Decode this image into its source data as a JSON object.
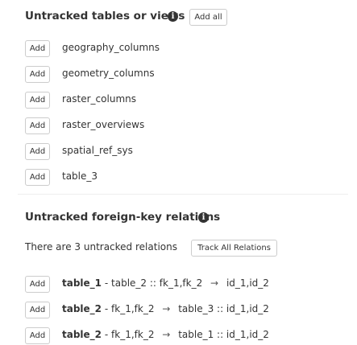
{
  "untracked_tables": {
    "title": "Untracked tables or views",
    "add_all_label": "Add all",
    "items": [
      {
        "add_label": "Add",
        "name": "geography_columns"
      },
      {
        "add_label": "Add",
        "name": "geometry_columns"
      },
      {
        "add_label": "Add",
        "name": "raster_columns"
      },
      {
        "add_label": "Add",
        "name": "raster_overviews"
      },
      {
        "add_label": "Add",
        "name": "spatial_ref_sys"
      },
      {
        "add_label": "Add",
        "name": "table_3"
      }
    ]
  },
  "untracked_relations": {
    "title": "Untracked foreign-key relations",
    "summary": "There are 3 untracked relations",
    "track_all_label": "Track All Relations",
    "items": [
      {
        "add_label": "Add",
        "table": "table_1",
        "sep": "-",
        "left": "table_2 :: fk_1,fk_2",
        "arrow": "→",
        "right": "id_1,id_2"
      },
      {
        "add_label": "Add",
        "table": "table_2",
        "sep": "-",
        "left": "fk_1,fk_2",
        "arrow": "→",
        "right": "table_3 :: id_1,id_2"
      },
      {
        "add_label": "Add",
        "table": "table_2",
        "sep": "-",
        "left": "fk_1,fk_2",
        "arrow": "→",
        "right": "table_1 :: id_1,id_2"
      }
    ]
  },
  "info_icon_glyph": "i"
}
